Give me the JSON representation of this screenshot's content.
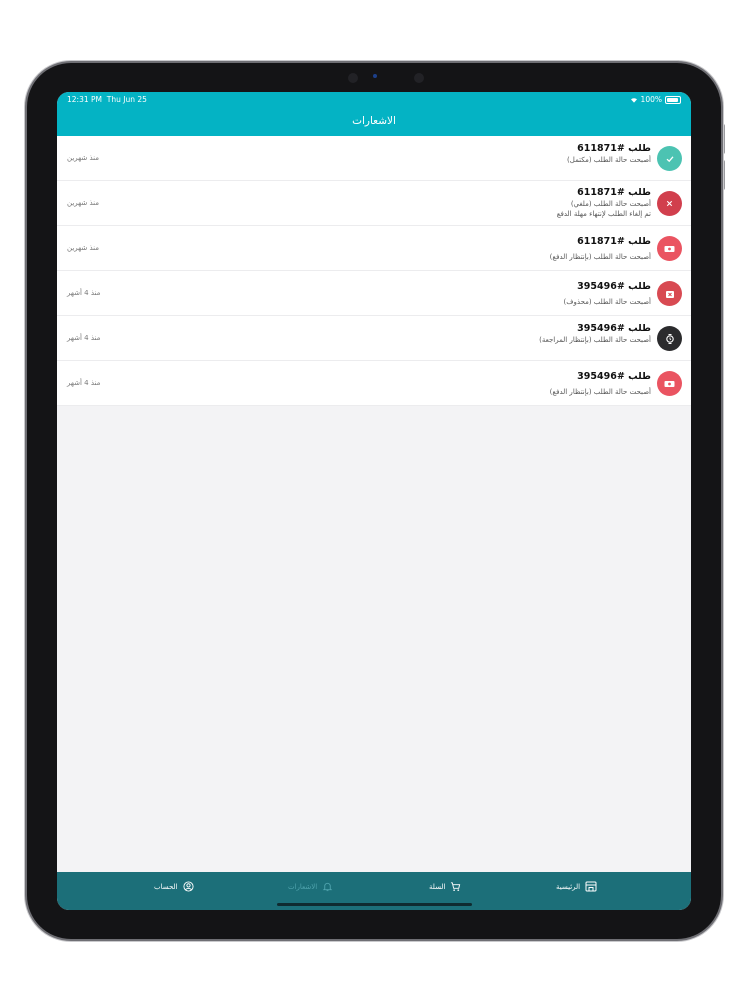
{
  "status": {
    "time": "12:31 PM",
    "date": "Thu Jun 25",
    "battery": "100%"
  },
  "header": {
    "title": "الاشعارات"
  },
  "notifications": [
    {
      "title": "طلب #611871",
      "subtitle": "أصبحت حالة الطلب (مكتمل)",
      "note": "",
      "time": "منذ شهرين",
      "icon": "check-icon",
      "color": "#4cc3b2"
    },
    {
      "title": "طلب #611871",
      "subtitle": "أصبحت حالة الطلب (ملغي)",
      "note": "تم إلغاء الطلب لإنتهاء مهلة الدفع",
      "time": "منذ شهرين",
      "icon": "close-icon",
      "color": "#d13f4d"
    },
    {
      "title": "طلب #611871",
      "subtitle": "أصبحت حالة الطلب (بإنتظار الدفع)",
      "note": "",
      "time": "منذ شهرين",
      "icon": "money-icon",
      "color": "#ea5461"
    },
    {
      "title": "طلب #395496",
      "subtitle": "أصبحت حالة الطلب (محذوف)",
      "note": "",
      "time": "منذ 4 أشهر",
      "icon": "trash-icon",
      "color": "#d84a52"
    },
    {
      "title": "طلب #395496",
      "subtitle": "أصبحت حالة الطلب (بإنتظار المراجعة)",
      "note": "",
      "time": "منذ 4 أشهر",
      "icon": "clock-icon",
      "color": "#2b2b2d"
    },
    {
      "title": "طلب #395496",
      "subtitle": "أصبحت حالة الطلب (بإنتظار الدفع)",
      "note": "",
      "time": "منذ 4 أشهر",
      "icon": "money-icon",
      "color": "#ea5461"
    }
  ],
  "tabs": {
    "account": "الحساب",
    "notifications": "الاشعارات",
    "cart": "السلة",
    "home": "الرئيسية"
  }
}
